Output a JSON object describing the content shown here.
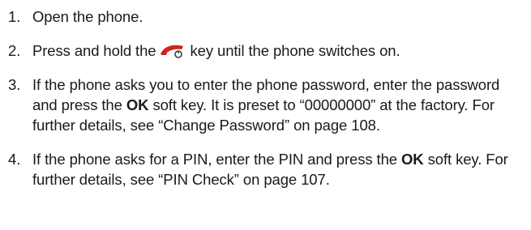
{
  "steps": [
    {
      "number": "1.",
      "text": "Open the phone."
    },
    {
      "number": "2.",
      "text_before_icon": "Press and hold the",
      "icon": "power-end-key-icon",
      "text_after_icon": "key until the phone switches on."
    },
    {
      "number": "3.",
      "text_before_bold": "If the phone asks you to enter the phone password, enter the password and press the",
      "bold": "OK",
      "text_after_bold": "soft key. It is preset to “00000000” at the factory. For further details, see “Change Password” on page 108."
    },
    {
      "number": "4.",
      "text_before_bold": "If the phone asks for a PIN, enter the PIN and press the",
      "bold": "OK",
      "text_after_bold": "soft key. For further details, see “PIN Check” on page 107."
    }
  ],
  "colors": {
    "text": "#1a1a1a",
    "icon_red": "#d3231d",
    "icon_dark": "#3a3a3a"
  }
}
